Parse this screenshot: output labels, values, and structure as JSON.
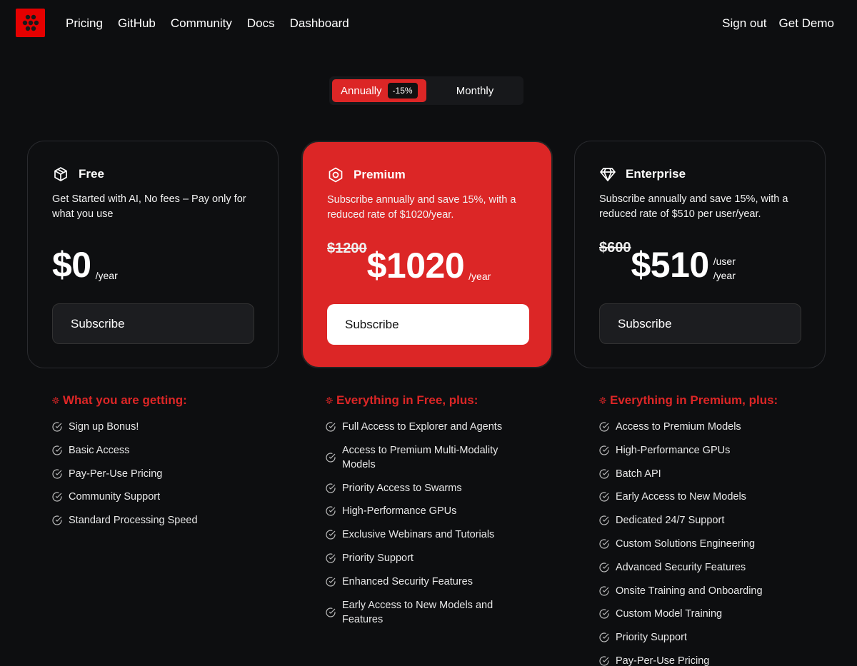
{
  "nav": {
    "links": [
      "Pricing",
      "GitHub",
      "Community",
      "Docs",
      "Dashboard"
    ],
    "right": [
      "Sign out",
      "Get Demo"
    ],
    "logo_icon": "hexagon-cluster-logo",
    "logo_color": "#e50000"
  },
  "billing_toggle": {
    "annual_label": "Annually",
    "discount_badge": "-15%",
    "monthly_label": "Monthly",
    "active": "Annually",
    "accent": "#dc2626"
  },
  "plans": [
    {
      "name": "Free",
      "icon": "box-icon",
      "description": "Get Started with AI, No fees – Pay only for what you use",
      "old_price": "",
      "price": "$0",
      "per": "/year",
      "button": "Subscribe"
    },
    {
      "name": "Premium",
      "icon": "hexagon-nut-icon",
      "description": "Subscribe annually and save 15%, with a reduced rate of $1020/year.",
      "old_price": "$1200",
      "price": "$1020",
      "per": "/year",
      "button": "Subscribe"
    },
    {
      "name": "Enterprise",
      "icon": "diamond-icon",
      "description": "Subscribe annually and save 15%, with a reduced rate of $510 per user/year.",
      "old_price": "$600",
      "price": "$510",
      "per_line1": "/user",
      "per_line2": "/year",
      "button": "Subscribe"
    }
  ],
  "features": [
    {
      "heading": "What you are getting:",
      "items": [
        "Sign up Bonus!",
        "Basic Access",
        "Pay-Per-Use Pricing",
        "Community Support",
        "Standard Processing Speed"
      ]
    },
    {
      "heading": "Everything in Free, plus:",
      "items": [
        "Full Access to Explorer and Agents",
        "Access to Premium Multi-Modality Models",
        "Priority Access to Swarms",
        "High-Performance GPUs",
        "Exclusive Webinars and Tutorials",
        "Priority Support",
        "Enhanced Security Features",
        "Early Access to New Models and Features"
      ]
    },
    {
      "heading": "Everything in Premium, plus:",
      "items": [
        "Access to Premium Models",
        "High-Performance GPUs",
        "Batch API",
        "Early Access to New Models",
        "Dedicated 24/7 Support",
        "Custom Solutions Engineering",
        "Advanced Security Features",
        "Onsite Training and Onboarding",
        "Custom Model Training",
        "Priority Support",
        "Pay-Per-Use Pricing"
      ]
    }
  ]
}
